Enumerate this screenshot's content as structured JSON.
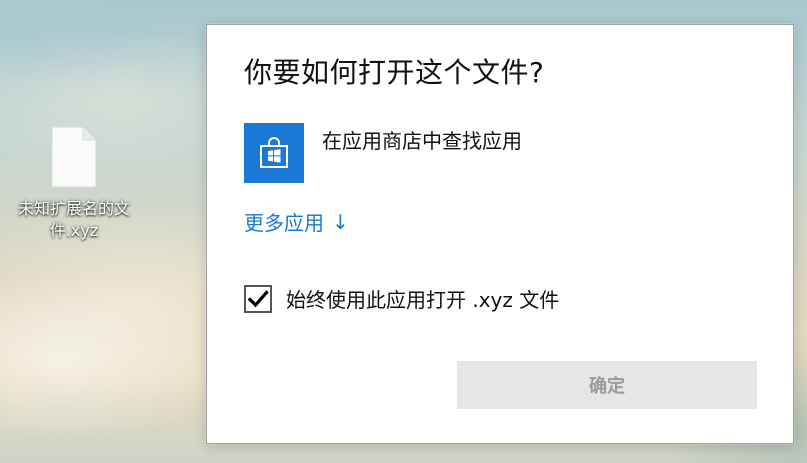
{
  "desktop": {
    "file_icon": {
      "label": "未知扩展名的文件.xyz",
      "icon": "blank-document-icon"
    }
  },
  "dialog": {
    "title": "你要如何打开这个文件?",
    "store_option": {
      "label": "在应用商店中查找应用",
      "icon": "store-icon",
      "tile_color": "#1a79d6"
    },
    "more_apps": {
      "label": "更多应用",
      "arrow": "↓",
      "color": "#1a79d6"
    },
    "always_use": {
      "label": "始终使用此应用打开 .xyz 文件",
      "checked": true
    },
    "ok_button": {
      "label": "确定",
      "enabled": false
    }
  }
}
